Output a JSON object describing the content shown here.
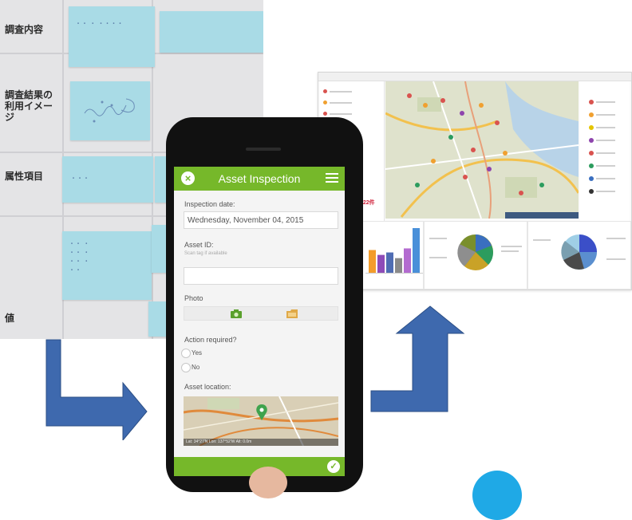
{
  "board": {
    "labels": {
      "survey_content": "調査内容",
      "result_image": "調査結果の利用イメージ",
      "attributes": "属性項目",
      "values": "値"
    },
    "notes": {
      "survey_note": "・・ ・ ・・・・",
      "attribute_note": "・・・",
      "values_note": "・・ ・\n・・ ・\n・・ ・\n・・"
    }
  },
  "app": {
    "title": "Asset Inspection",
    "inspection_date_label": "Inspection date:",
    "inspection_date_value": "Wednesday, November 04, 2015",
    "asset_id_label": "Asset ID:",
    "asset_id_hint": "Scan tag if available",
    "asset_id_value": "",
    "photo_label": "Photo",
    "action_label": "Action required?",
    "options": [
      "Yes",
      "No"
    ],
    "location_label": "Asset location:",
    "coords": "Lat: 34°27'N  Lon: 137°52'W  Alt: 0.0m",
    "accent": "#76b82a"
  },
  "dashboard": {
    "count": "122件",
    "bar_colors": [
      "#f39c2b",
      "#8e4cb8",
      "#4f6db3",
      "#8a8a8a",
      "#b36bd0",
      "#4a90d9"
    ],
    "bar_values": [
      0.28,
      0.22,
      0.25,
      0.18,
      0.3,
      0.55
    ]
  },
  "colors": {
    "arrow": "#3e69ae",
    "circle": "#1fa9e6"
  }
}
